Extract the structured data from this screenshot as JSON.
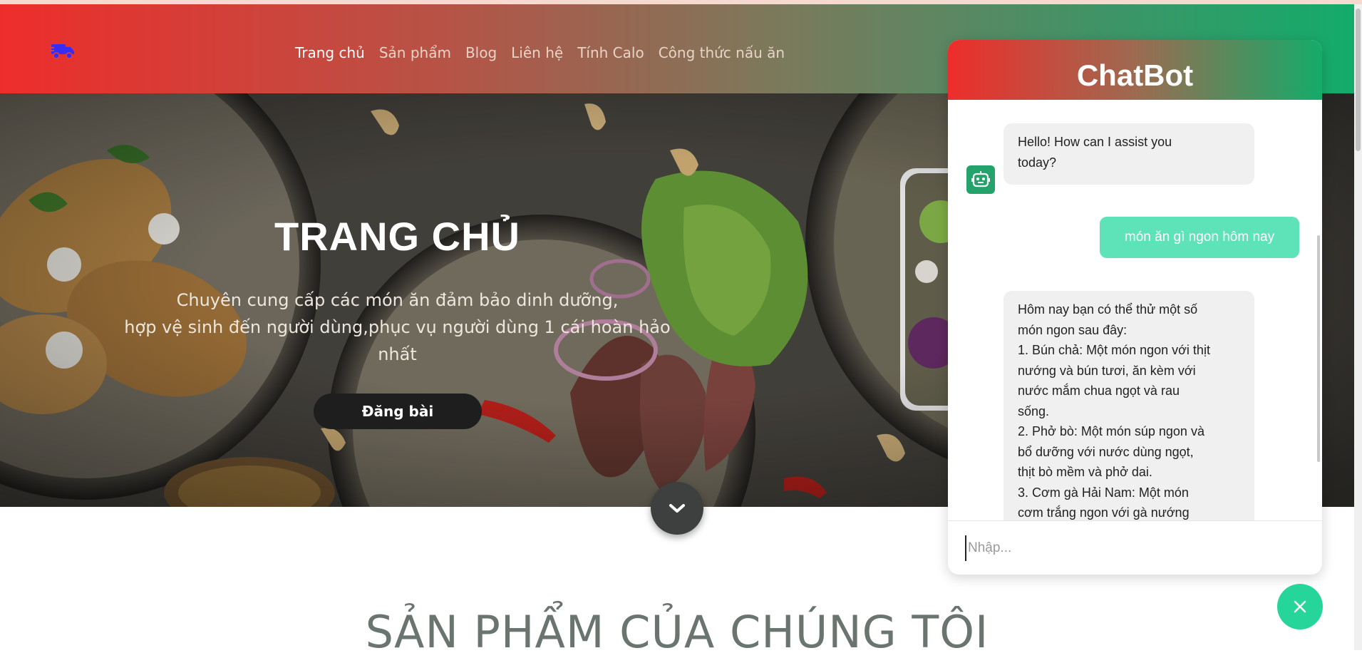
{
  "colors": {
    "header_start": "#ee2d2b",
    "header_end": "#13ac6a",
    "user_bubble": "#5ee3b9",
    "close_button": "#26d59a",
    "bot_avatar": "#23a36b"
  },
  "header": {
    "logo_icon": "delivery-truck-icon",
    "nav": [
      {
        "label": "Trang chủ",
        "active": true
      },
      {
        "label": "Sản phẩm"
      },
      {
        "label": "Blog"
      },
      {
        "label": "Liên hệ"
      },
      {
        "label": "Tính Calo"
      },
      {
        "label": "Công thức nấu ăn"
      }
    ]
  },
  "hero": {
    "title": "TRANG CHỦ",
    "description_lines": [
      "Chuyên cung cấp các món ăn đảm bảo dinh dưỡng,",
      "hợp vệ sinh đến người dùng,phục vụ người dùng 1 cái hoàn hảo",
      "nhất"
    ],
    "button_label": "Đăng bài",
    "scroll_icon": "chevron-down-icon"
  },
  "section": {
    "title": "SẢN PHẨM CỦA CHÚNG TÔI"
  },
  "chatbot": {
    "title": "ChatBot",
    "bot_icon": "robot-icon",
    "messages": [
      {
        "from": "bot",
        "lines": [
          "Hello! How can I assist you",
          "today?"
        ]
      },
      {
        "from": "user",
        "text": "món ăn gì ngon hôm nay"
      },
      {
        "from": "bot",
        "lines": [
          "Hôm nay bạn có thể thử một số",
          "món ngon sau đây:",
          "1. Bún chả: Một món ngon với thịt",
          "nướng và bún tươi, ăn kèm với",
          "nước mắm chua ngọt và rau",
          "sống.",
          "2. Phở bò: Một món súp ngon và",
          "bổ dưỡng với nước dùng ngọt,",
          "thịt bò mềm và phở dai.",
          "3. Cơm gà Hải Nam: Một món",
          "cơm trắng ngon với gà nướng"
        ]
      }
    ],
    "input_placeholder": "Nhập...",
    "close_icon": "close-icon"
  }
}
